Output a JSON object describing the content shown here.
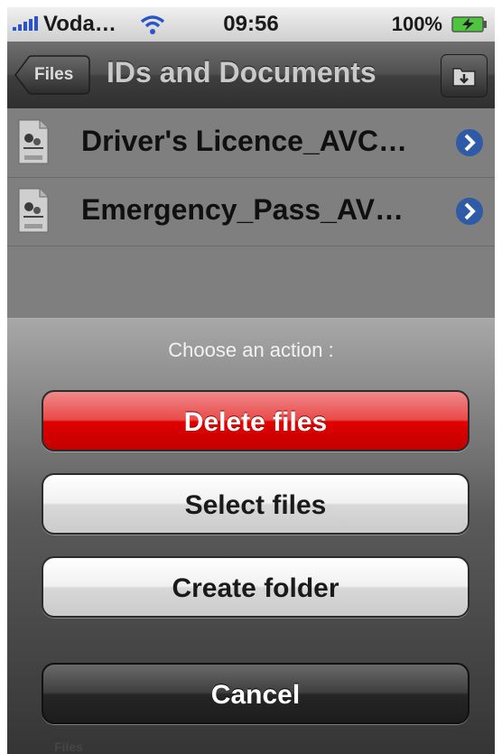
{
  "status_bar": {
    "carrier": "Voda…",
    "time": "09:56",
    "battery": "100%"
  },
  "nav": {
    "back_label": "Files",
    "title": "IDs and Documents",
    "folder_icon": "folder-import-icon"
  },
  "files": [
    {
      "name": "Driver's Licence_AVC…",
      "icon": "jpeg-file-icon"
    },
    {
      "name": "Emergency_Pass_AV…",
      "icon": "jpeg-file-icon"
    }
  ],
  "action_sheet": {
    "title": "Choose an action :",
    "delete_label": "Delete files",
    "select_label": "Select files",
    "create_label": "Create folder",
    "cancel_label": "Cancel"
  },
  "tab_bar": {
    "items": [
      "Files"
    ]
  },
  "colors": {
    "destructive": "#e00000",
    "accent": "#2a55c9"
  }
}
